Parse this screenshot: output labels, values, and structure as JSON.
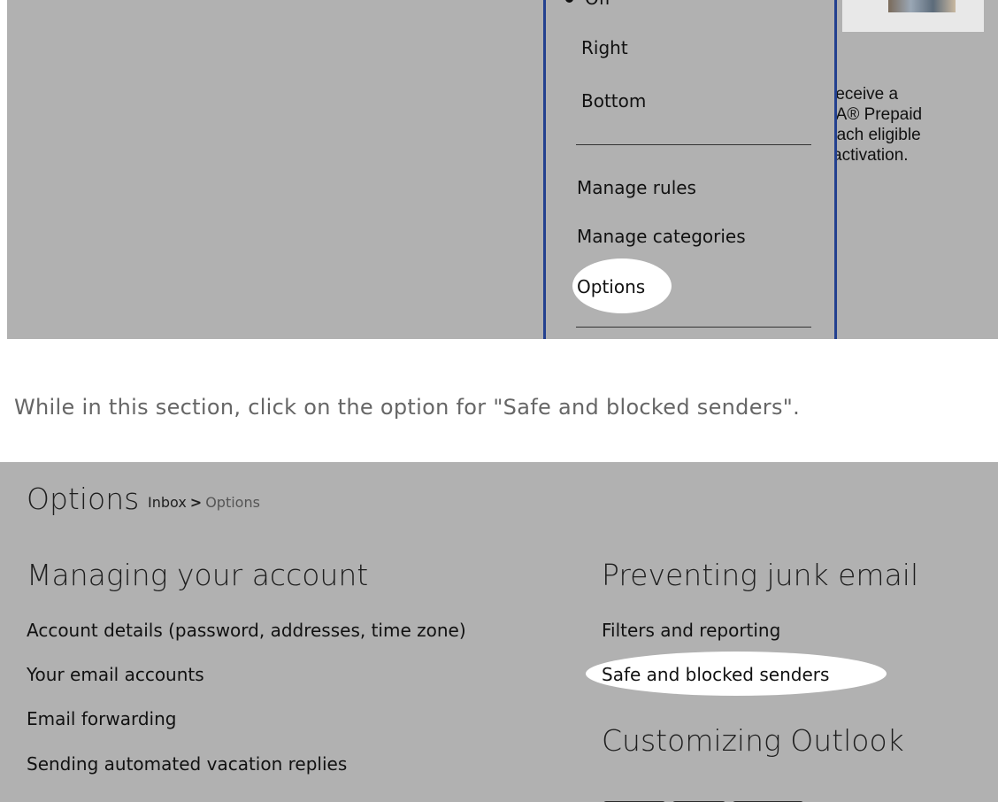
{
  "menu": {
    "partial_item": "Off",
    "items": [
      "Right",
      "Bottom"
    ],
    "actions": [
      "Manage rules",
      "Manage categories",
      "Options"
    ]
  },
  "promo": {
    "lines": [
      "receive a",
      "SA® Prepaid",
      "each eligible",
      "activation."
    ]
  },
  "instruction": "While in this section, click on the option for \"Safe and blocked senders\".",
  "options_page": {
    "title": "Options",
    "breadcrumb": {
      "parent": "Inbox",
      "separator": ">",
      "current": "Options"
    },
    "left_section": {
      "heading": "Managing your account",
      "links": [
        "Account details (password, addresses, time zone)",
        "Your email accounts",
        "Email forwarding",
        "Sending automated vacation replies"
      ]
    },
    "right_section": {
      "heading": "Preventing junk email",
      "links": [
        "Filters and reporting",
        "Safe and blocked senders"
      ],
      "heading2": "Customizing Outlook"
    }
  },
  "colors": {
    "screenshot_bg": "#b1b1b1",
    "menu_border": "#23408f",
    "highlight": "#ffffff",
    "instruction_text": "#666666"
  }
}
